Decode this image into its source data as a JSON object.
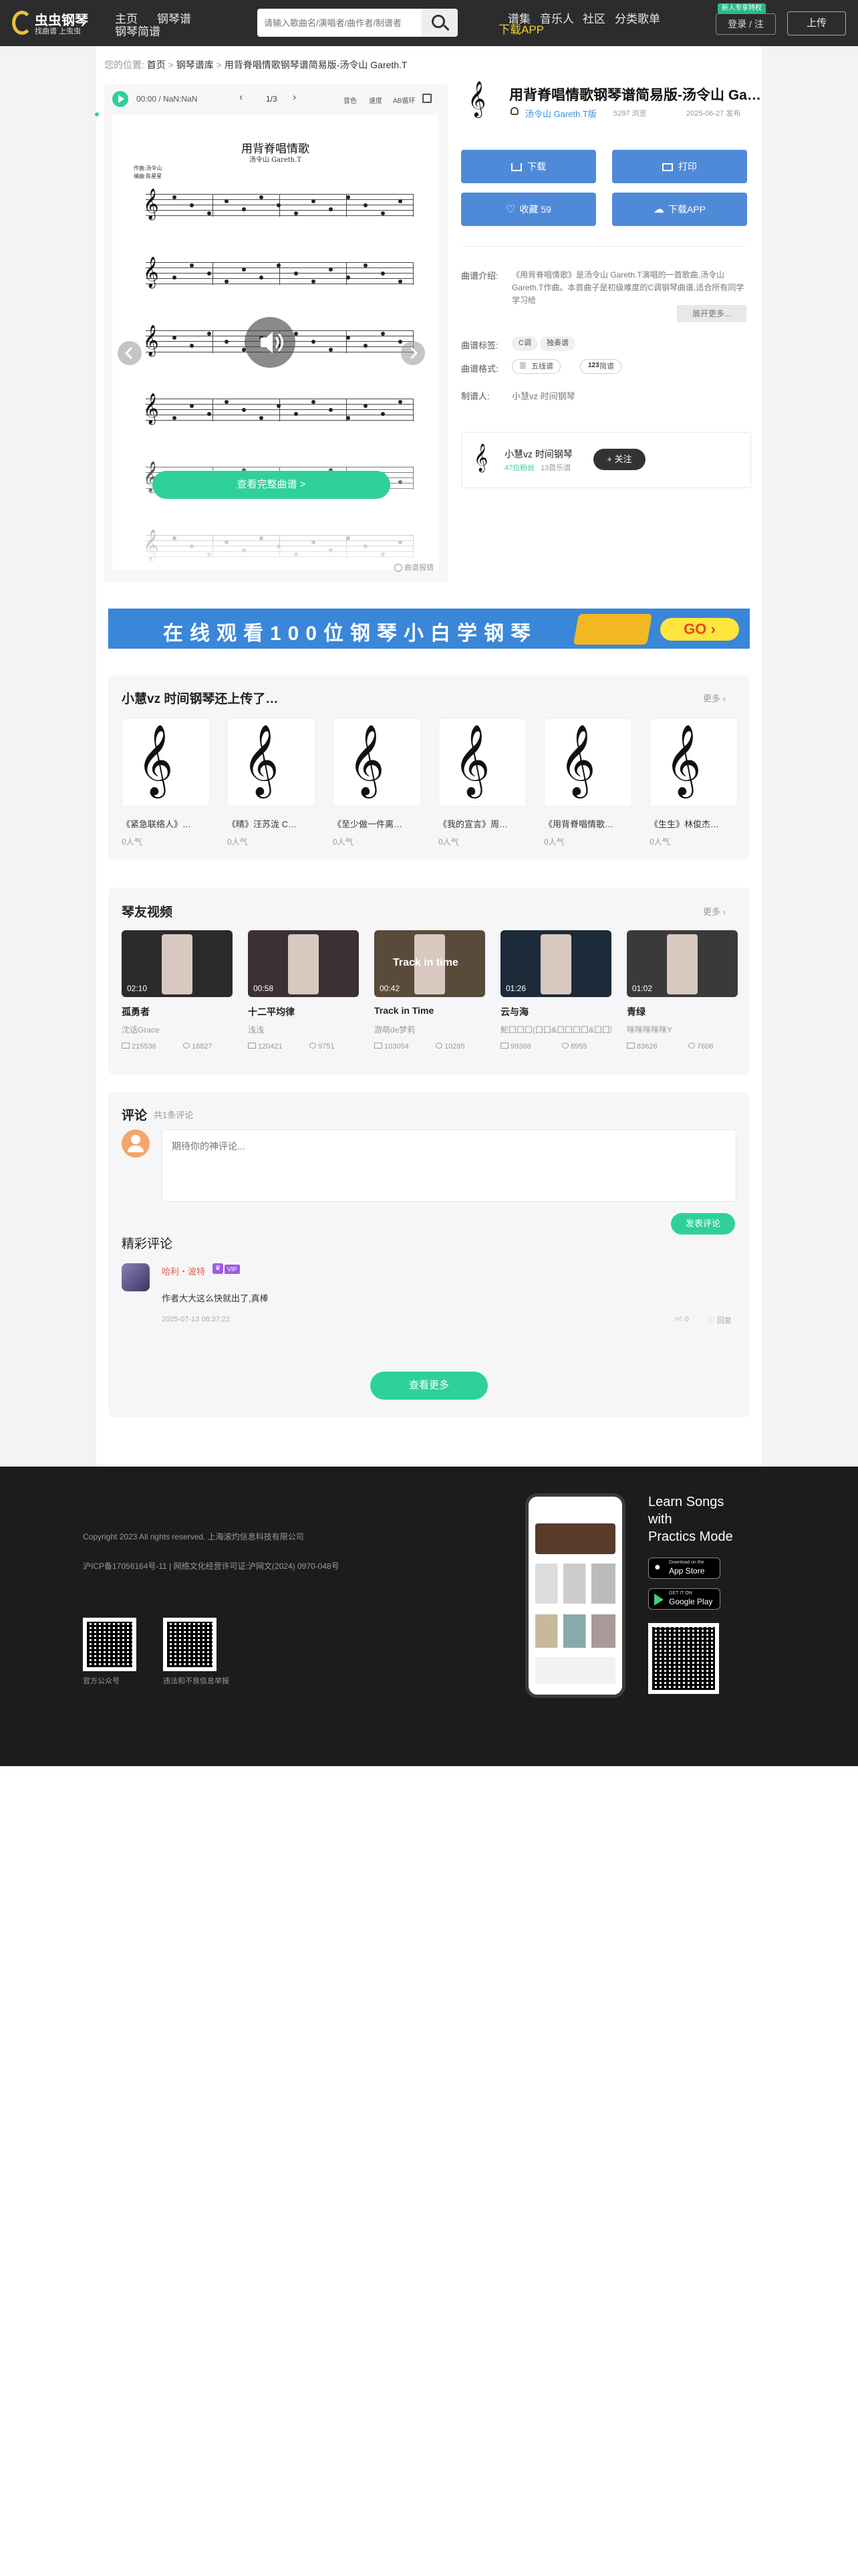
{
  "nav": {
    "brand": "虫虫钢琴",
    "slogan": "找曲谱 上虫虫",
    "links_left": [
      "主页",
      "钢琴谱",
      "钢琴简谱"
    ],
    "search_placeholder": "请输入歌曲名/演唱者/曲作者/制谱者",
    "links_right": [
      "谱集",
      "音乐人",
      "社区",
      "分类歌单"
    ],
    "download_app": "下载APP",
    "newbie_tag": "新人专享特权",
    "login": "登录 / 注",
    "upload": "上传"
  },
  "breadcrumb": {
    "label": "您的位置:",
    "home": "首页",
    "sep1": ">",
    "category": "钢琴谱库",
    "sep2": ">",
    "current": "用背脊唱情歌钢琴谱简易版-汤令山 Gareth.T"
  },
  "player": {
    "time": "00:00 / NaN:NaN",
    "page": "1/3",
    "prev": "‹",
    "next": "›",
    "tools": [
      "音色",
      "速度",
      "AB循环"
    ]
  },
  "sheet": {
    "title": "用背脊唱情歌",
    "composer": "汤令山 Gareth.T",
    "credits": "作曲:汤令山\n编曲:陈星星",
    "cta": "查看完整曲谱 >",
    "report": "曲谱报错"
  },
  "score": {
    "title": "用背脊唱情歌钢琴谱简易版-汤令山 Ga…",
    "author": "汤令山 Gareth.T版",
    "views": "5297 浏览",
    "date": "2025-06-27 发布",
    "buttons": {
      "download": "下载",
      "print": "打印",
      "favorite": "收藏 59",
      "download_app": "下载APP"
    },
    "intro_label": "曲谱介绍:",
    "intro_text": "《用背脊唱情歌》是汤令山 Gareth.T演唱的一首歌曲,汤令山 Gareth.T作曲。本首曲子是初级难度的C调钢琴曲谱,适合所有同学学习给",
    "expand": "展开更多...",
    "tags_label": "曲谱标签:",
    "tags": [
      "C调",
      "独奏谱"
    ],
    "format_label": "曲谱格式:",
    "formats": [
      "五线谱",
      "简谱"
    ],
    "arranger_label": "制谱人:",
    "arranger": "小慧vz 时间钢琴"
  },
  "uploader": {
    "name": "小慧vz 时间钢琴",
    "fans": "47位粉丝",
    "uploads": "13首乐谱",
    "follow": "+ 关注"
  },
  "banner": {
    "text": "在线观看100位钢琴小白学钢琴",
    "go": "GO ›"
  },
  "uploads_section": {
    "title": "小慧vz 时间钢琴还上传了…",
    "more": "更多 ›",
    "items": [
      {
        "title": "《紧急联络人》…",
        "pop": "0人气"
      },
      {
        "title": "《晴》汪苏泷 C…",
        "pop": "0人气"
      },
      {
        "title": "《至少做一件离…",
        "pop": "0人气"
      },
      {
        "title": "《我的宣言》周…",
        "pop": "0人气"
      },
      {
        "title": "《用背脊唱情歌…",
        "pop": "0人气"
      },
      {
        "title": "《生生》林俊杰…",
        "pop": "0人气"
      }
    ]
  },
  "videos_section": {
    "title": "琴友视频",
    "more": "更多 ›",
    "items": [
      {
        "duration": "02:10",
        "title": "孤勇者",
        "author": "沈话Grace",
        "plays": "215536",
        "comments": "18827",
        "overlay": ""
      },
      {
        "duration": "00:58",
        "title": "十二平均律",
        "author": "浅浅",
        "plays": "120421",
        "comments": "9751",
        "overlay": ""
      },
      {
        "duration": "00:42",
        "title": "Track in Time",
        "author": "游萌de梦莉",
        "plays": "103054",
        "comments": "10285",
        "overlay": "Track in time"
      },
      {
        "duration": "01:26",
        "title": "云与海",
        "author": "鮀囗囗囗(囗囗&囗囗囗囗&囗囗囗)",
        "plays": "99368",
        "comments": "8955",
        "overlay": ""
      },
      {
        "duration": "01:02",
        "title": "青绿",
        "author": "咪咪咪咪咪Y",
        "plays": "83626",
        "comments": "7606",
        "overlay": ""
      }
    ]
  },
  "comments": {
    "title": "评论",
    "count": "共1条评论",
    "placeholder": "期待你的神评论...",
    "submit": "发表评论",
    "featured_title": "精彩评论",
    "items": [
      {
        "user": "哈利・波特",
        "vip": "VIP",
        "text": "作者大大这么快就出了,真棒",
        "time": "2025-07-13 08:37:22",
        "likes": "0",
        "reply": "回复"
      }
    ],
    "view_more": "查看更多"
  },
  "footer": {
    "copyright": "Copyright 2023 All rights reserved. 上海滚灼信息科技有限公司",
    "icp": "沪ICP备17056164号-11 | 网络文化经营许可证:沪网文(2024) 0970-048号",
    "qr1": "官方公众号",
    "qr2": "违法和不良信息举报",
    "promo": "Learn Songs\nwith\nPractics Mode",
    "app_store_small": "Download on the",
    "app_store": "App Store",
    "google_small": "GET IT ON",
    "google": "Google Play"
  },
  "colors": {
    "accent_green": "#2fd19a",
    "blue_button": "#4f8ad9",
    "nav_bg": "#2c2c2e",
    "footer_bg": "#1c1c1c",
    "link_blue": "#3a8ee6",
    "vip_purple": "#9b5de5"
  }
}
